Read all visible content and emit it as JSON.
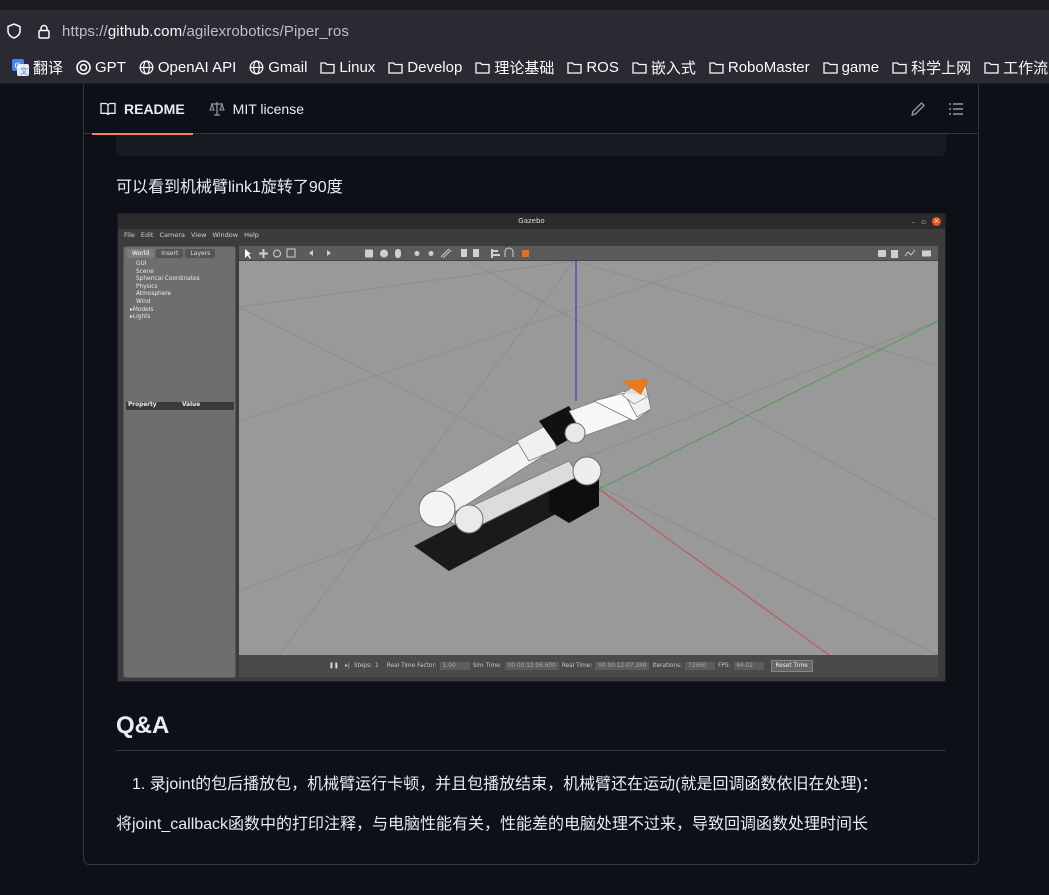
{
  "browser": {
    "url_prefix": "https://",
    "url_host": "github.com",
    "url_path": "/agilexrobotics/Piper_ros",
    "bookmarks": [
      {
        "label": "翻译",
        "icon": "translate-icon"
      },
      {
        "label": "GPT",
        "icon": "openai-icon"
      },
      {
        "label": "OpenAI API",
        "icon": "globe-icon"
      },
      {
        "label": "Gmail",
        "icon": "globe-icon"
      },
      {
        "label": "Linux",
        "icon": "folder-icon"
      },
      {
        "label": "Develop",
        "icon": "folder-icon"
      },
      {
        "label": "理论基础",
        "icon": "folder-icon"
      },
      {
        "label": "ROS",
        "icon": "folder-icon"
      },
      {
        "label": "嵌入式",
        "icon": "folder-icon"
      },
      {
        "label": "RoboMaster",
        "icon": "folder-icon"
      },
      {
        "label": "game",
        "icon": "folder-icon"
      },
      {
        "label": "科学上网",
        "icon": "folder-icon"
      },
      {
        "label": "工作流",
        "icon": "folder-icon"
      }
    ]
  },
  "readme": {
    "tabs": [
      {
        "label": "README",
        "icon": "book-icon",
        "active": true
      },
      {
        "label": "MIT license",
        "icon": "scale-icon",
        "active": false
      }
    ],
    "para1": "可以看到机械臂link1旋转了90度",
    "heading_qa": "Q&A",
    "list_item_1": "1. 录joint的包后播放包，机械臂运行卡顿，并且包播放结束，机械臂还在运动(就是回调函数依旧在处理)：",
    "para2": "将joint_callback函数中的打印注释，与电脑性能有关，性能差的电脑处理不过来，导致回调函数处理时间长"
  },
  "gazebo": {
    "title": "Gazebo",
    "menu": [
      "File",
      "Edit",
      "Camera",
      "View",
      "Window",
      "Help"
    ],
    "panel_tabs": [
      "World",
      "Insert",
      "Layers"
    ],
    "tree": [
      "GUI",
      "Scene",
      "Spherical Coordinates",
      "Physics",
      "Atmosphere",
      "Wind",
      "Models",
      "Lights"
    ],
    "prop_headers": [
      "Property",
      "Value"
    ],
    "status": {
      "steps_label": "Steps:",
      "steps_value": "1",
      "rtf_label": "Real Time Factor:",
      "rtf_value": "1.00",
      "sim_time_label": "Sim Time:",
      "sim_time_value": "00 00:12:06.600",
      "real_time_label": "Real Time:",
      "real_time_value": "00 00:12:07.348",
      "iterations_label": "Iterations:",
      "iterations_value": "72660",
      "fps_label": "FPS:",
      "fps_value": "64.02",
      "reset_label": "Reset Time"
    }
  }
}
